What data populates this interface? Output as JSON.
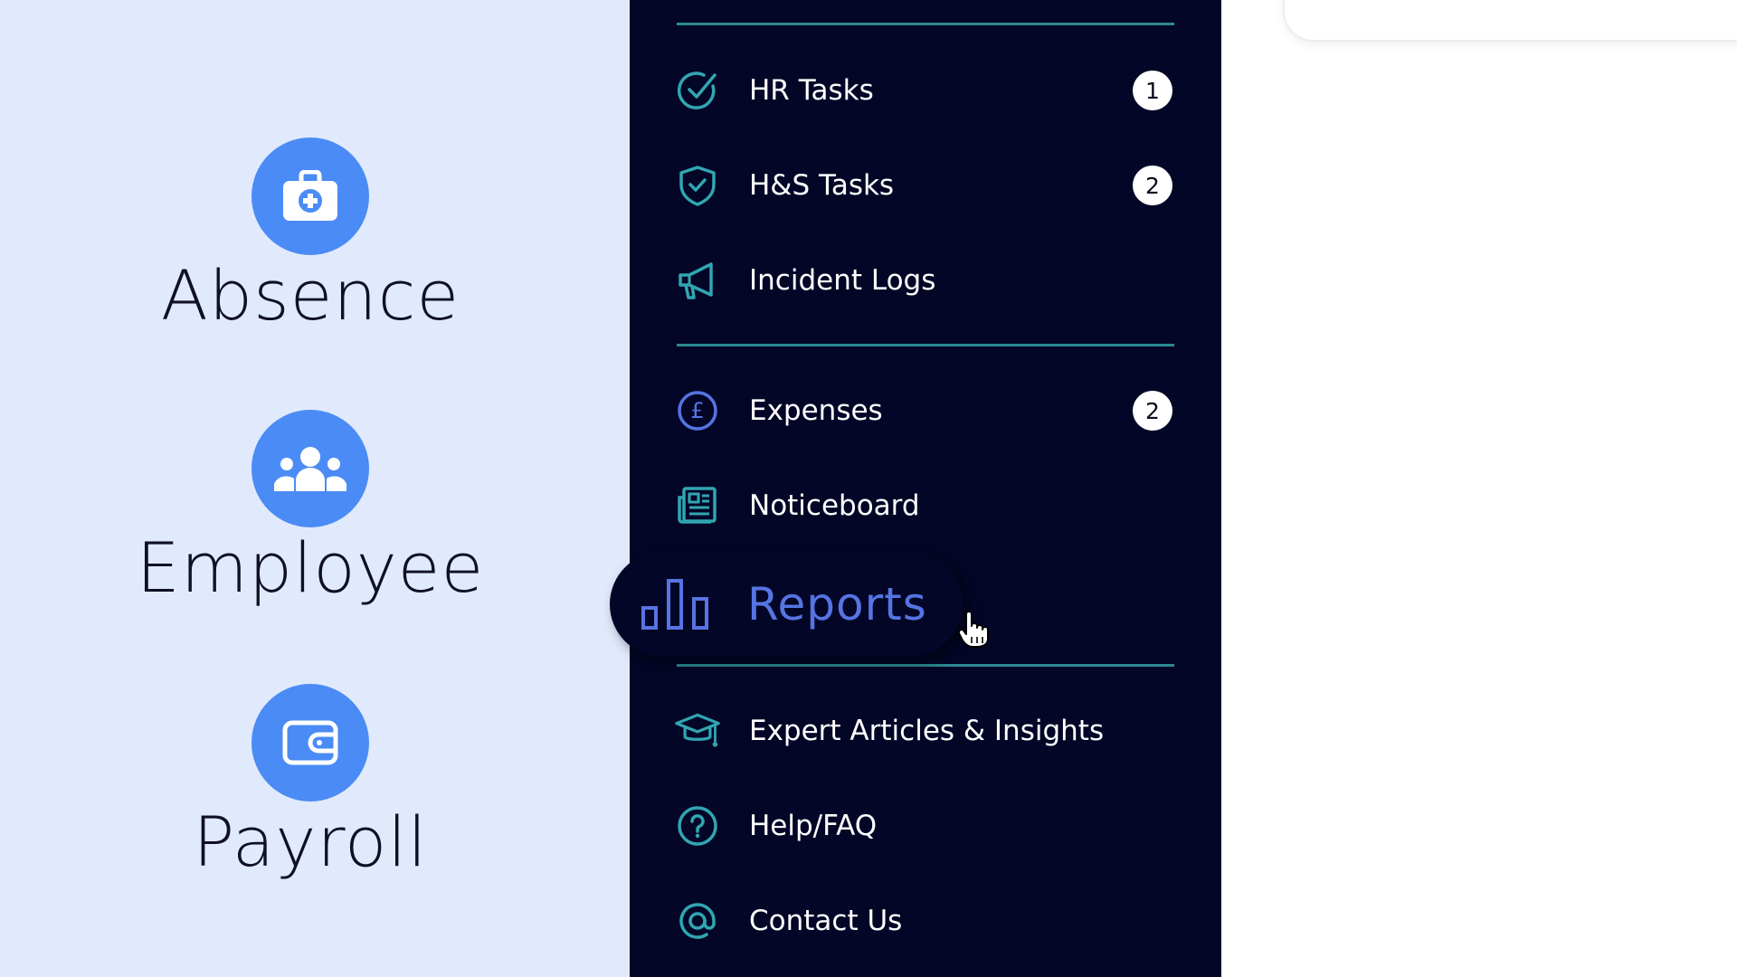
{
  "features": [
    {
      "label": "Absence",
      "icon": "first-aid-kit-icon"
    },
    {
      "label": "Employee",
      "icon": "team-icon"
    },
    {
      "label": "Payroll",
      "icon": "wallet-icon"
    }
  ],
  "nav": {
    "hr_tasks": {
      "label": "HR Tasks",
      "badge": "1",
      "icon": "check-circle-icon"
    },
    "hs_tasks": {
      "label": "H&S Tasks",
      "badge": "2",
      "icon": "shield-check-icon"
    },
    "incident_logs": {
      "label": "Incident Logs",
      "icon": "megaphone-icon"
    },
    "expenses": {
      "label": "Expenses",
      "badge": "2",
      "icon": "pound-coin-icon"
    },
    "noticeboard": {
      "label": "Noticeboard",
      "icon": "newspaper-icon"
    },
    "reports": {
      "label": "Reports",
      "icon": "bar-chart-icon"
    },
    "expert_articles": {
      "label": "Expert Articles & Insights",
      "icon": "graduation-cap-icon"
    },
    "help_faq": {
      "label": "Help/FAQ",
      "icon": "question-circle-icon"
    },
    "contact_us": {
      "label": "Contact Us",
      "icon": "at-sign-icon"
    }
  },
  "colors": {
    "left_bg": "#e1eafc",
    "feature_circle": "#4b8bf5",
    "nav_bg": "#030626",
    "divider": "#2b8a93",
    "icon_teal": "#31a6b2",
    "icon_blue": "#5674e3",
    "reports_text": "#5674e3"
  }
}
